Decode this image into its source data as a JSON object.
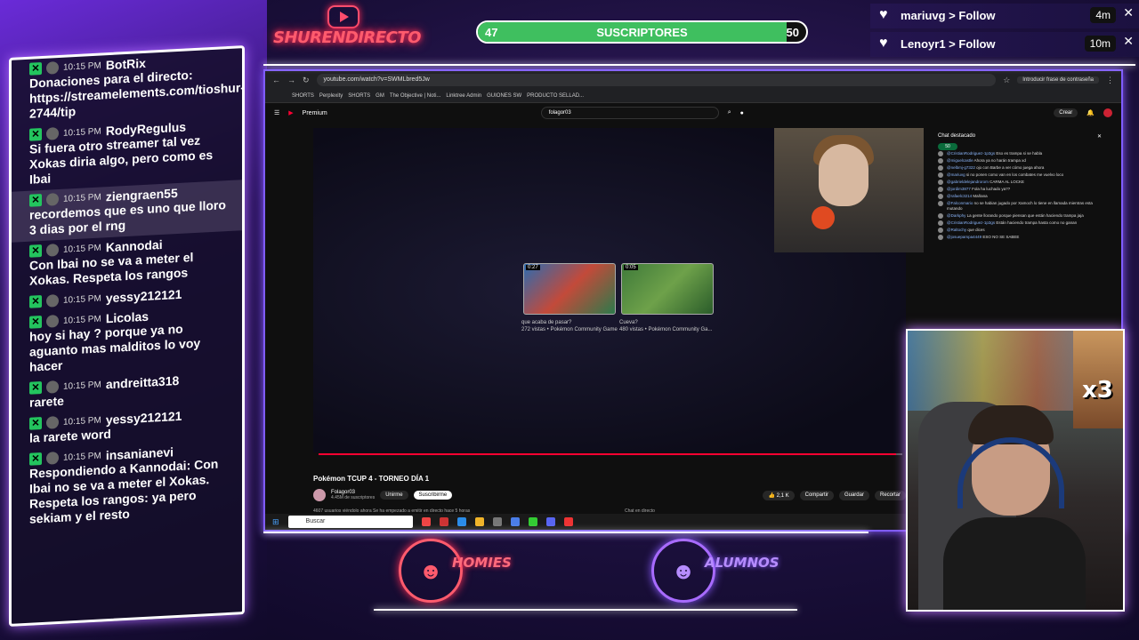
{
  "overlay": {
    "brand": "SHURENDIRECTO",
    "subs": {
      "current": "47",
      "label": "SUSCRIPTORES",
      "goal": "50",
      "progress": 0.94
    },
    "follows": [
      {
        "name": "mariuvg > Follow",
        "time": "4m"
      },
      {
        "name": "Lenoyr1 > Follow",
        "time": "10m"
      }
    ],
    "homies_label": "HOMIES",
    "alumnos_label": "ALUMNOS",
    "multiplier": "x3"
  },
  "chat": [
    {
      "time": "10:15 PM",
      "user": "BotRix",
      "text": "Donaciones para el directo: https://streamelements.com/tioshur-2744/tip"
    },
    {
      "time": "10:15 PM",
      "user": "RodyRegulus",
      "text": "Si fuera otro streamer tal vez Xokas diria algo, pero como es Ibai"
    },
    {
      "time": "10:15 PM",
      "user": "ziengraen55",
      "text": "recordemos que es uno que lloro 3 dias por el rng",
      "highlight": true
    },
    {
      "time": "10:15 PM",
      "user": "Kannodai",
      "text": "Con Ibai no se va a meter el Xokas. Respeta los rangos"
    },
    {
      "time": "10:15 PM",
      "user": "yessy212121",
      "text": ""
    },
    {
      "time": "10:15 PM",
      "user": "Licolas",
      "text": "hoy si hay ? porque ya no aguanto mas malditos lo voy hacer"
    },
    {
      "time": "10:15 PM",
      "user": "andreitta318",
      "text": "rarete"
    },
    {
      "time": "10:15 PM",
      "user": "yessy212121",
      "text": "la rarete word"
    },
    {
      "time": "10:15 PM",
      "user": "insanianevi",
      "text": "Respondiendo a Kannodai: Con Ibai no se va a meter el Xokas. Respeta los rangos: ya pero sekiam y el resto"
    }
  ],
  "browser": {
    "url": "youtube.com/watch?v=SWMLbred5Jw",
    "password_prompt": "Introducir frase de contraseña",
    "bookmarks": [
      "SHORTS",
      "Perplexity",
      "SHORTS",
      "GM",
      "The Objective | Noti...",
      "Linktree Admin",
      "GUIONES SW",
      "PRODUCTO SELLAD..."
    ],
    "yt_premium": "Premium",
    "search_value": "folagor03",
    "create_label": "Crear",
    "video_title": "Pokémon TCUP 4 - TORNEO DÍA 1",
    "channel": "Folagor03",
    "channel_subs": "4.45M de suscriptores",
    "join_label": "Unirme",
    "subscribe_label": "Suscribirme",
    "likes": "2,1 K",
    "share_label": "Compartir",
    "save_label": "Guardar",
    "clip_label": "Recortar",
    "watching": "4607 usuarios viéndolo ahora  Se ha empezado a emitir en directo hace 5 horas",
    "chat_live_label": "Chat en directo",
    "taskbar_search": "Buscar",
    "thumbs": [
      {
        "dur": "0:27",
        "title": "que acaba de pasar?",
        "meta": "272 vistas • Pokémon Community Game"
      },
      {
        "dur": "0:05",
        "title": "Cueva?",
        "meta": "480 vistas • Pokémon Community Ga..."
      }
    ],
    "side_chat": {
      "header": "Chat destacado",
      "pill": "50",
      "lines": [
        {
          "user": "@CristianRodriguez-1p3gs",
          "text": "Eso es trampa si se habla"
        },
        {
          "user": "@miguelcastle",
          "text": "Ahora ya no harán trampa xd"
        },
        {
          "user": "@nelbmj-g7322",
          "text": "ojo con Barbe a ver cómo juega ahora"
        },
        {
          "user": "@mariuvg",
          "text": "si no ponen como van en los combates me vuelvo loco"
        },
        {
          "user": "@gabrieldelejandrorom",
          "text": "CARMA AL LOCKE"
        },
        {
          "user": "@jordim3877",
          "text": "Fola ha luchado ya??"
        },
        {
          "user": "@rafaelc3214",
          "text": "Mañana"
        },
        {
          "user": "@Falconmario",
          "text": "no se habian jugado por Xamoch lo tiene en llamada mientras esta mutando"
        },
        {
          "user": "@Darkphy",
          "text": "La gente llorando porque piensan que están haciendo trampa jaja"
        },
        {
          "user": "@CristianRodriguez-1p3gs",
          "text": "Están haciendo trampa hasta como no ganan"
        },
        {
          "user": "@Raltochy",
          "text": "que dices"
        },
        {
          "user": "@josuepampa4449",
          "text": "ESO NO SE SABEE"
        }
      ]
    }
  },
  "colors": {
    "accent": "#8a5cff",
    "brand": "#ff4d6d",
    "progress": "#3fbf5f",
    "yt_red": "#ff0033"
  }
}
